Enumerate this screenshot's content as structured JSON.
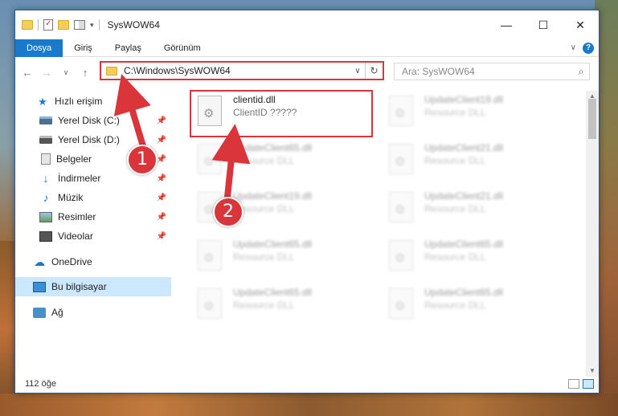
{
  "title": "SysWOW64",
  "window_controls": {
    "minimize": "—",
    "maximize": "☐",
    "close": "✕"
  },
  "ribbon": {
    "tabs": [
      "Dosya",
      "Giriş",
      "Paylaş",
      "Görünüm"
    ],
    "expand_icon": "∨",
    "help": "?"
  },
  "nav": {
    "back": "←",
    "forward": "→",
    "recent": "∨",
    "up": "↑"
  },
  "address": {
    "path": "C:\\Windows\\SysWOW64",
    "dropdown": "∨",
    "refresh": "↻"
  },
  "search": {
    "placeholder": "Ara: SysWOW64",
    "icon": "⌕"
  },
  "sidebar": {
    "items": [
      {
        "label": "Hızlı erişim",
        "icon": "star-icon",
        "pinned": false
      },
      {
        "label": "Yerel Disk (C:)",
        "icon": "drive-icon",
        "pinned": true
      },
      {
        "label": "Yerel Disk (D:)",
        "icon": "drive-icon",
        "pinned": true
      },
      {
        "label": "Belgeler",
        "icon": "documents-icon",
        "pinned": true
      },
      {
        "label": "İndirmeler",
        "icon": "downloads-icon",
        "pinned": true
      },
      {
        "label": "Müzik",
        "icon": "music-icon",
        "pinned": true
      },
      {
        "label": "Resimler",
        "icon": "pictures-icon",
        "pinned": true
      },
      {
        "label": "Videolar",
        "icon": "videos-icon",
        "pinned": true
      },
      {
        "label": "OneDrive",
        "icon": "onedrive-icon",
        "pinned": false
      },
      {
        "label": "Bu bilgisayar",
        "icon": "this-pc-icon",
        "pinned": false
      },
      {
        "label": "Ağ",
        "icon": "network-icon",
        "pinned": false
      }
    ],
    "pin_glyph": "📌"
  },
  "files": [
    {
      "name": "clientid.dll",
      "desc": "ClientID ?????",
      "blurred": false
    },
    {
      "name": "UpdateClient19.dll",
      "desc": "Resource DLL",
      "blurred": true
    },
    {
      "name": "UpdateClient65.dll",
      "desc": "Resource DLL",
      "blurred": true
    },
    {
      "name": "UpdateClient21.dll",
      "desc": "Resource DLL",
      "blurred": true
    },
    {
      "name": "UpdateClient19.dll",
      "desc": "Resource DLL",
      "blurred": true
    },
    {
      "name": "UpdateClient21.dll",
      "desc": "Resource DLL",
      "blurred": true
    },
    {
      "name": "UpdateClient65.dll",
      "desc": "Resource DLL",
      "blurred": true
    },
    {
      "name": "UpdateClient65.dll",
      "desc": "Resource DLL",
      "blurred": true
    },
    {
      "name": "UpdateClient65.dll",
      "desc": "Resource DLL",
      "blurred": true
    },
    {
      "name": "UpdateClient65.dll",
      "desc": "Resource DLL",
      "blurred": true
    }
  ],
  "status": {
    "count": "112 öğe"
  },
  "annotations": {
    "step1": "1",
    "step2": "2",
    "accent": "#d9353b"
  }
}
